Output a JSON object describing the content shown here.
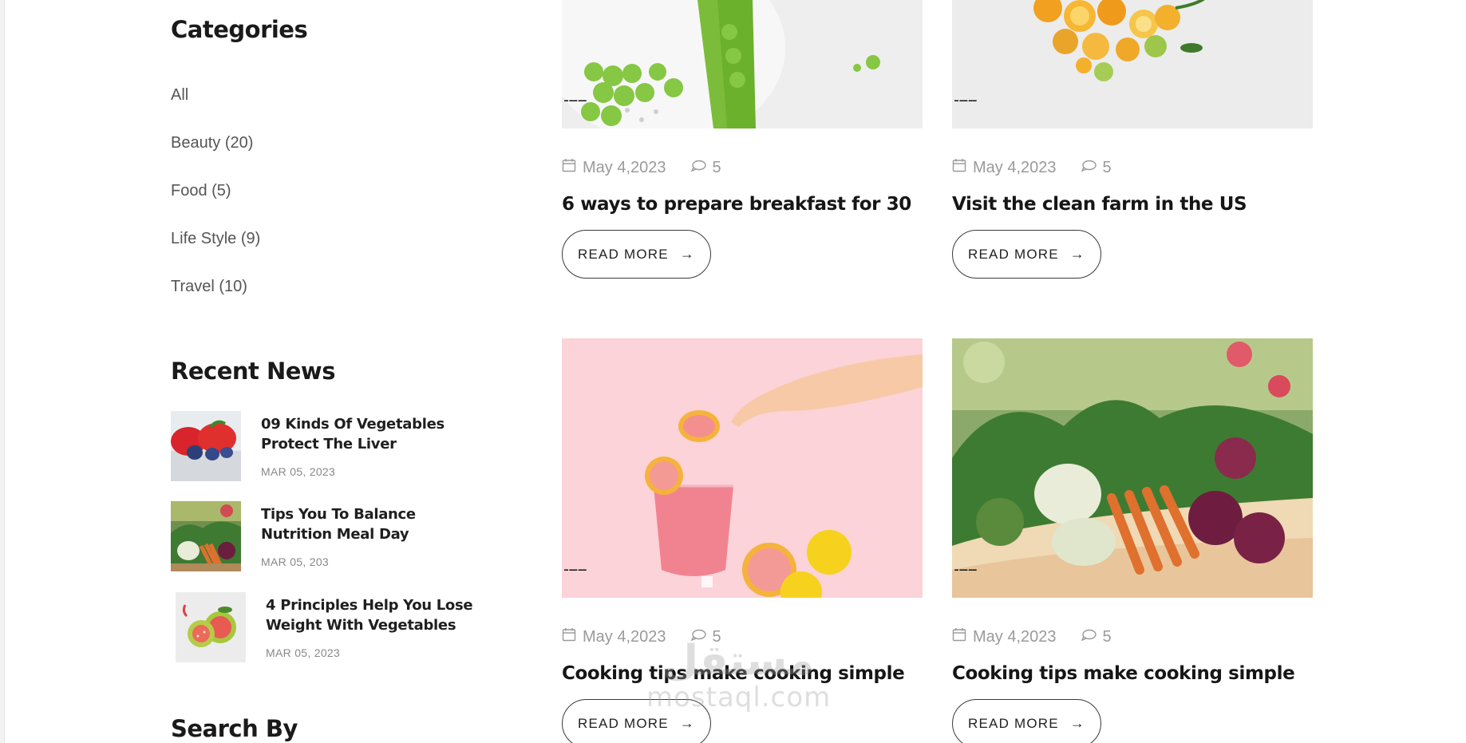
{
  "sidebar": {
    "categories_title": "Categories",
    "categories": [
      {
        "label": "All"
      },
      {
        "label": "Beauty (20)"
      },
      {
        "label": "Food (5)"
      },
      {
        "label": "Life Style (9)"
      },
      {
        "label": "Travel (10)"
      }
    ],
    "recent_title": "Recent News",
    "recent": [
      {
        "title": "09 Kinds Of Vegetables Protect The Liver",
        "date": "MAR 05, 2023",
        "thumb": "strawberries-blueberries"
      },
      {
        "title": "Tips You To Balance Nutrition Meal Day",
        "date": "MAR 05, 203",
        "thumb": "vegetable-basket"
      },
      {
        "title": "4 Principles Help You Lose Weight With Vegetables",
        "date": "MAR 05, 2023",
        "thumb": "guava-fruit"
      }
    ],
    "search_title": "Search By"
  },
  "posts": [
    {
      "date": "May 4,2023",
      "comments": "5",
      "title": "6 ways to prepare breakfast for 30",
      "read_more": "READ MORE",
      "image": "green-peas"
    },
    {
      "date": "May 4,2023",
      "comments": "5",
      "title": "Visit the clean farm in the US",
      "read_more": "READ MORE",
      "image": "citrus-fruits"
    },
    {
      "date": "May 4,2023",
      "comments": "5",
      "title": "Cooking tips make cooking simple",
      "read_more": "READ MORE",
      "image": "grapefruit-drink"
    },
    {
      "date": "May 4,2023",
      "comments": "5",
      "title": "Cooking tips make cooking simple",
      "read_more": "READ MORE",
      "image": "vegetable-basket"
    }
  ],
  "watermark": {
    "arabic": "مستقل",
    "latin": "mostaql.com"
  },
  "colors": {
    "title": "#161616",
    "meta": "#9a9a9a",
    "button_border": "#3a3a3a",
    "pink_bg": "#fbd3d8"
  }
}
